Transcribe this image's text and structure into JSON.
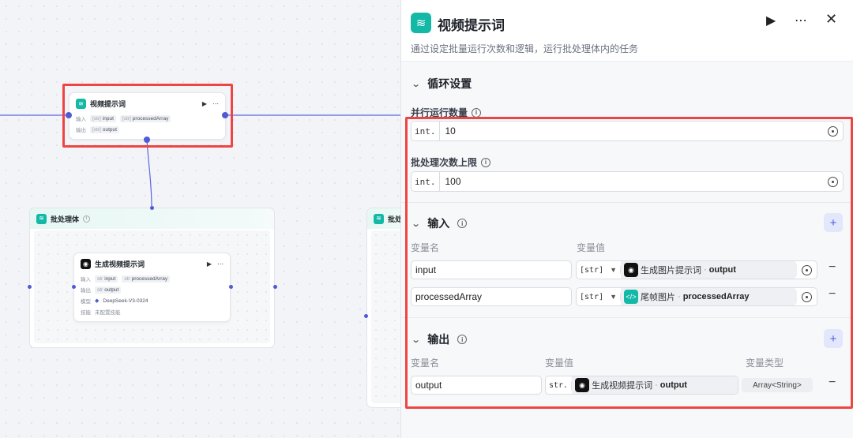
{
  "canvas": {
    "loop_node": {
      "title": "视频提示词",
      "input_label": "输入",
      "output_label": "输出",
      "inputs": [
        {
          "type": "[str]",
          "name": "input"
        },
        {
          "type": "[str]",
          "name": "processedArray"
        }
      ],
      "outputs": [
        {
          "type": "[str]",
          "name": "output"
        }
      ]
    },
    "batch_group": {
      "title": "批处理体",
      "inner_node": {
        "title": "生成视频提示词",
        "input_label": "输入",
        "output_label": "输出",
        "model_label": "模型",
        "skill_label": "技能",
        "inputs": [
          {
            "type": "str",
            "name": "input"
          },
          {
            "type": "str",
            "name": "processedArray"
          }
        ],
        "outputs": [
          {
            "type": "str",
            "name": "output"
          }
        ],
        "model": "DeepSeek-V3-0324",
        "skill": "未配置技能"
      }
    },
    "second_group": {
      "title": "批处"
    }
  },
  "panel": {
    "title": "视频提示词",
    "description": "通过设定批量运行次数和逻辑，运行批处理体内的任务",
    "loop_section": {
      "title": "循环设置",
      "parallel_label": "并行运行数量",
      "parallel_type": "int.",
      "parallel_value": "10",
      "limit_label": "批处理次数上限",
      "limit_type": "int.",
      "limit_value": "100"
    },
    "input_section": {
      "title": "输入",
      "col_name": "变量名",
      "col_value": "变量值",
      "rows": [
        {
          "name": "input",
          "type": "[str]",
          "ref_node": "生成图片提示词",
          "ref_var": "output",
          "ref_icon": "model-icon"
        },
        {
          "name": "processedArray",
          "type": "[str]",
          "ref_node": "尾帧图片",
          "ref_var": "processedArray",
          "ref_icon": "code-icon"
        }
      ]
    },
    "output_section": {
      "title": "输出",
      "col_name": "变量名",
      "col_value": "变量值",
      "col_type": "变量类型",
      "rows": [
        {
          "name": "output",
          "type": "str.",
          "ref_node": "生成视频提示词",
          "ref_var": "output",
          "var_type": "Array<String>"
        }
      ]
    }
  },
  "colors": {
    "accent": "#4f5bd5",
    "teal": "#14b8a6",
    "highlight": "#ef4444"
  }
}
